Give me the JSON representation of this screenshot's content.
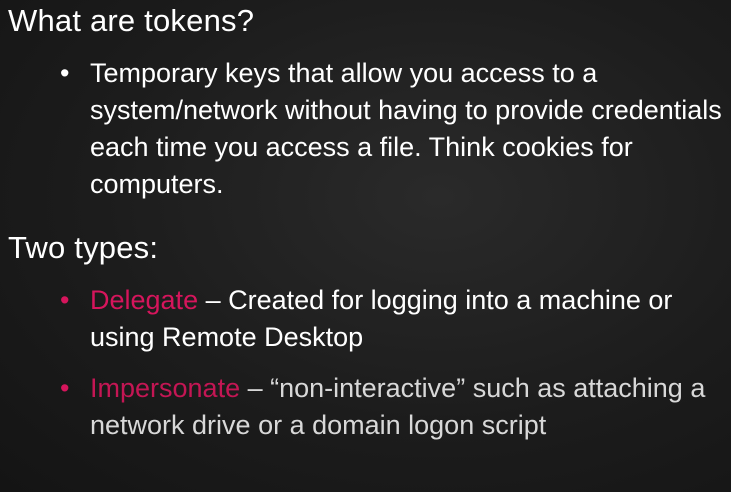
{
  "slide": {
    "heading_1": "What are tokens?",
    "bullet_1": {
      "marker": "•",
      "text": "Temporary keys that allow you access to a system/network without having to provide credentials each time you access a file. Think cookies for computers."
    },
    "heading_2": "Two types:",
    "bullet_2": {
      "marker": "•",
      "term": "Delegate",
      "text": " – Created for logging into a machine or using Remote Desktop"
    },
    "bullet_3": {
      "marker": "•",
      "term": "Impersonate",
      "text": " – “non-interactive” such as attaching a network drive or a domain logon script"
    }
  },
  "colors": {
    "background": "#1c1c1c",
    "text": "#ffffff",
    "accent": "#d6155c"
  }
}
